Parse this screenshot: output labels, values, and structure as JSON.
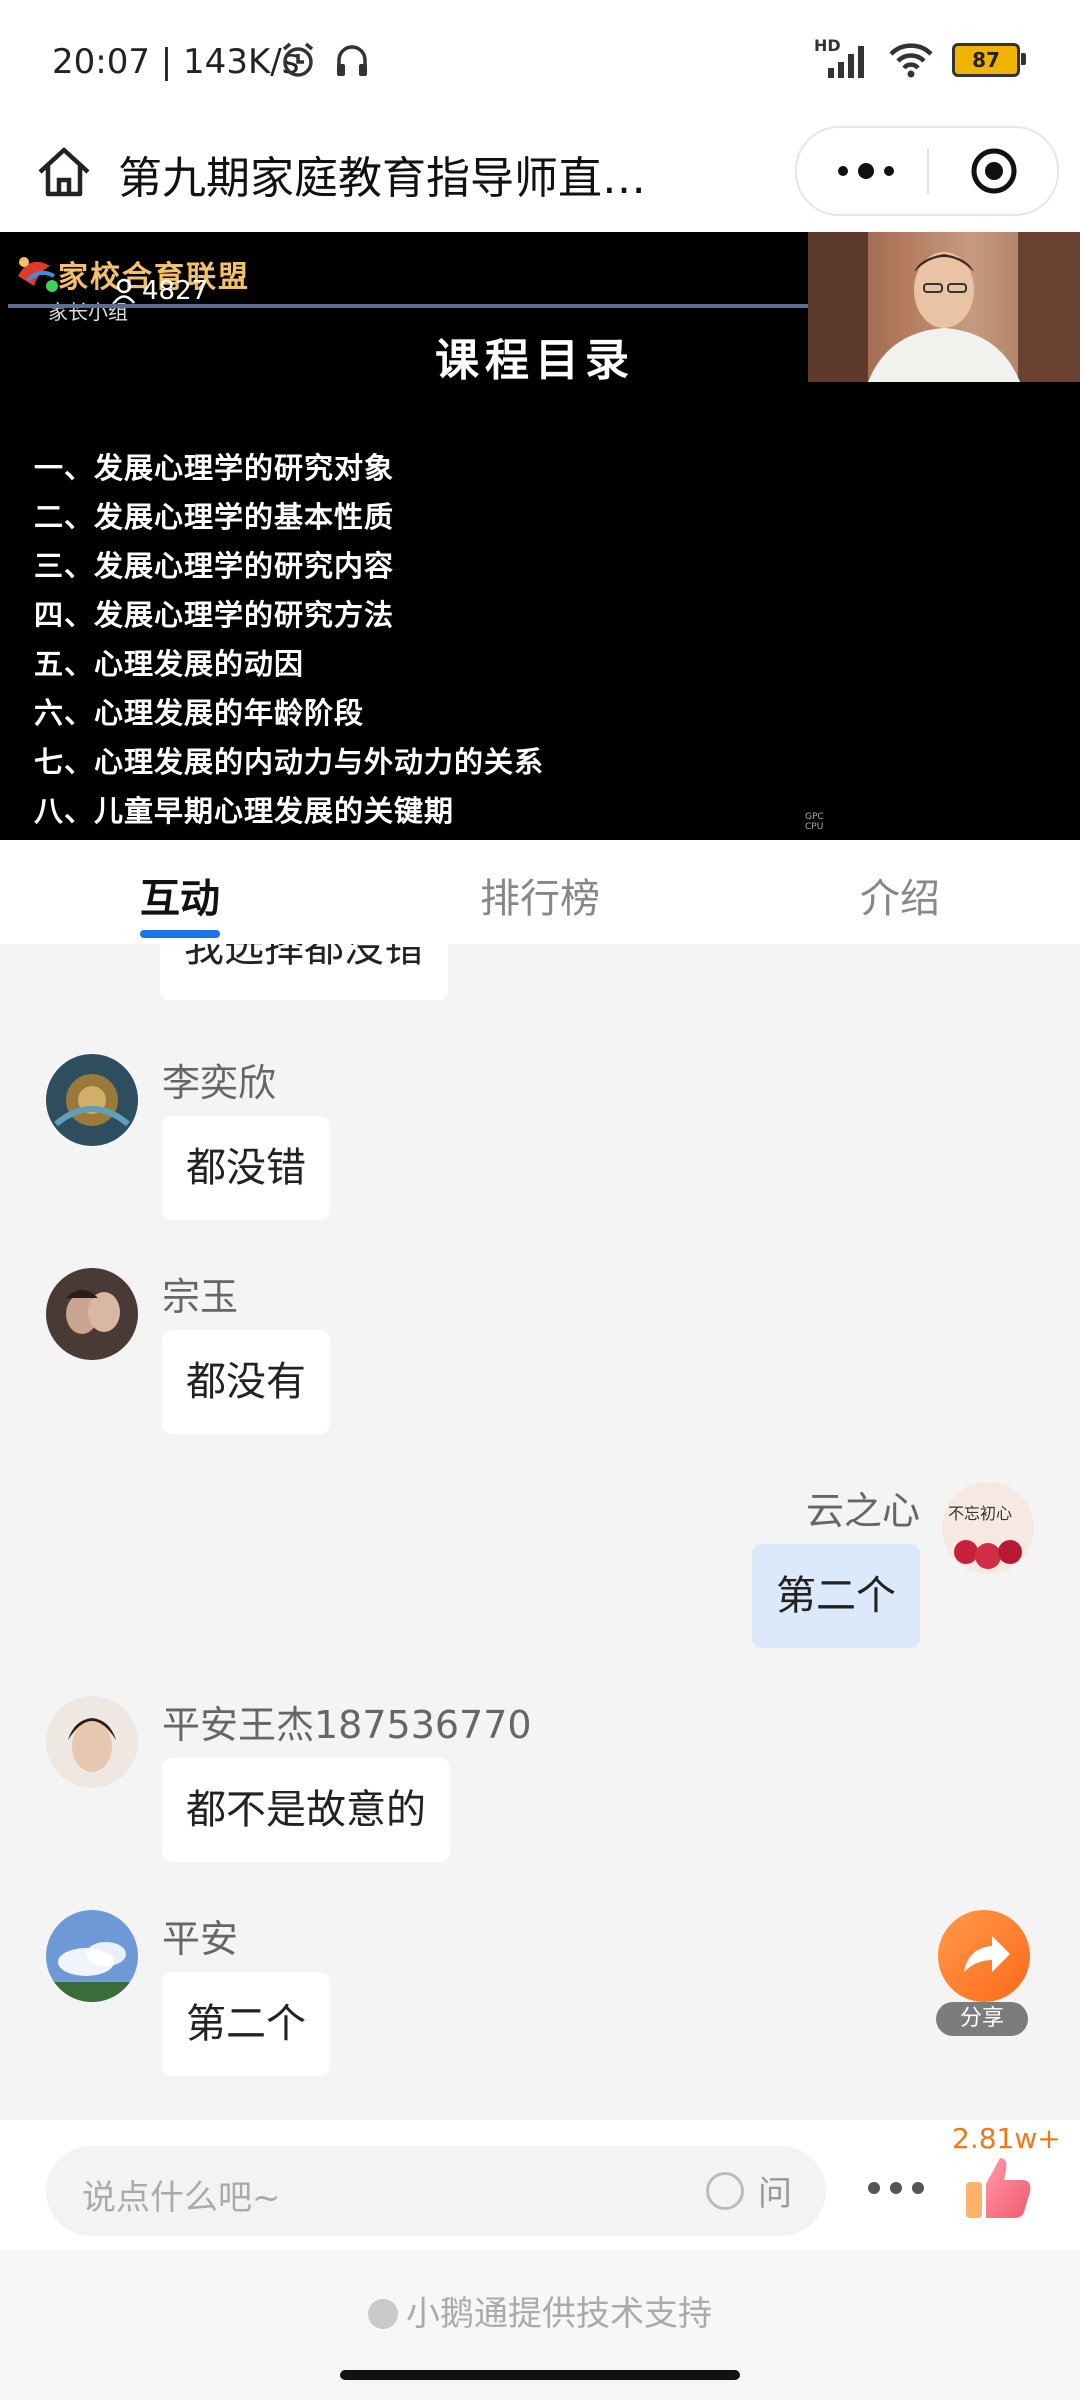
{
  "status_bar": {
    "time": "20:07 | 143K/s",
    "icons": [
      "alarm-icon",
      "headset-icon"
    ],
    "network": "HD",
    "battery": "87"
  },
  "header": {
    "title": "第九期家庭教育指导师直…"
  },
  "video": {
    "logo_text": "家校合育联盟",
    "logo_subtext": "家长小组",
    "viewer_count": "4827",
    "slide_title": "课程目录",
    "slide_items": [
      "一、发展心理学的研究对象",
      "二、发展心理学的基本性质",
      "三、发展心理学的研究内容",
      "四、发展心理学的研究方法",
      "五、心理发展的动因",
      "六、心理发展的年龄阶段",
      "七、心理发展的内动力与外动力的关系",
      "八、儿童早期心理发展的关键期"
    ],
    "cpu_tag": [
      "GPC",
      "CPU"
    ]
  },
  "tabs": [
    {
      "label": "互动",
      "active": true
    },
    {
      "label": "排行榜",
      "active": false
    },
    {
      "label": "介绍",
      "active": false
    }
  ],
  "messages": [
    {
      "name": "",
      "text": "我选择都没错",
      "mine": false
    },
    {
      "name": "李奕欣",
      "text": "都没错",
      "mine": false
    },
    {
      "name": "宗玉",
      "text": "都没有",
      "mine": false
    },
    {
      "name": "云之心",
      "text": "第二个",
      "mine": true,
      "avatar_text": "不忘初心"
    },
    {
      "name": "平安王杰187536770",
      "text": "都不是故意的",
      "mine": false
    },
    {
      "name": "平安",
      "text": "第二个",
      "mine": false
    }
  ],
  "share": {
    "label": "分享"
  },
  "input": {
    "placeholder": "说点什么吧~",
    "ask_label": "问"
  },
  "likes": {
    "count": "2.81w+"
  },
  "footer": {
    "powered_by": "小鹅通提供技术支持"
  },
  "colors": {
    "accent": "#1a73e8",
    "share": "#ff7a24",
    "likes": "#f07818",
    "my_bubble": "#dce9fb"
  }
}
